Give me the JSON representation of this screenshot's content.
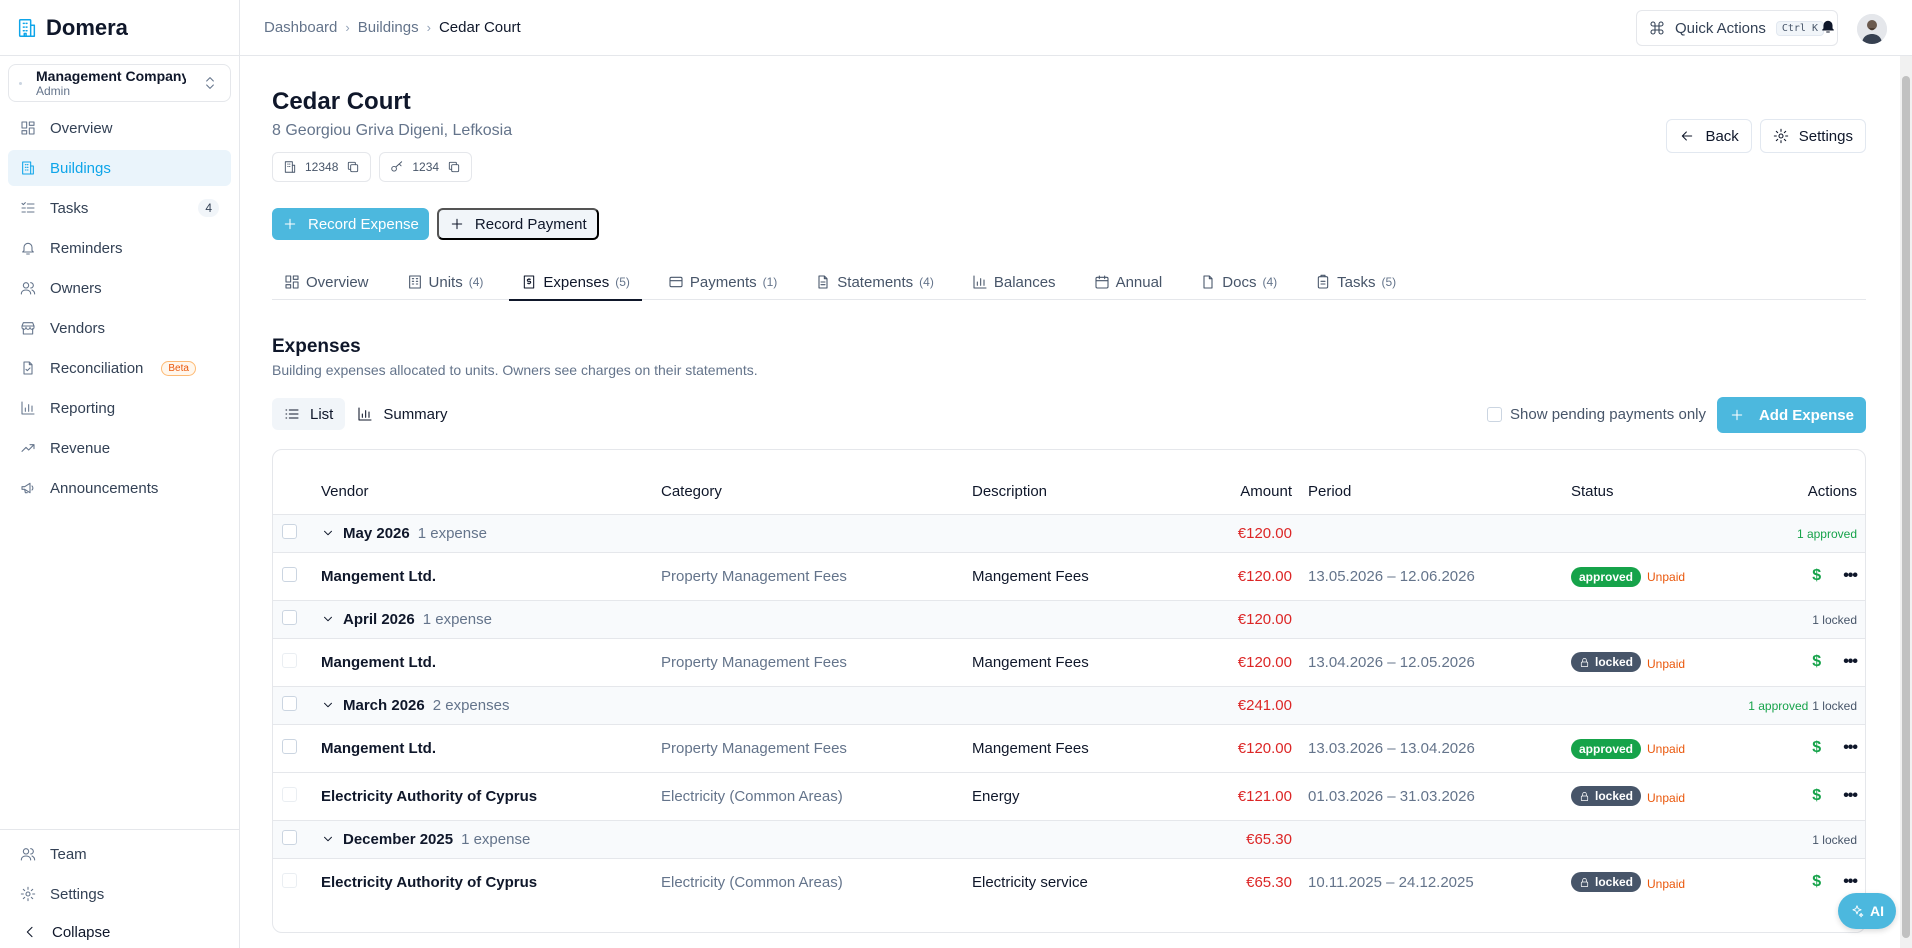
{
  "brand": {
    "name": "Domera"
  },
  "org": {
    "name": "Management Company",
    "role": "Admin"
  },
  "nav": [
    {
      "label": "Overview",
      "icon": "grid-icon"
    },
    {
      "label": "Buildings",
      "icon": "building-icon",
      "active": true
    },
    {
      "label": "Tasks",
      "icon": "tasks-icon",
      "count": "4"
    },
    {
      "label": "Reminders",
      "icon": "bell-icon"
    },
    {
      "label": "Owners",
      "icon": "users-icon"
    },
    {
      "label": "Vendors",
      "icon": "store-icon"
    },
    {
      "label": "Reconciliation",
      "icon": "file-check-icon",
      "badge": "Beta"
    },
    {
      "label": "Reporting",
      "icon": "bar-chart-icon"
    },
    {
      "label": "Revenue",
      "icon": "trend-icon"
    },
    {
      "label": "Announcements",
      "icon": "megaphone-icon"
    }
  ],
  "nav_bottom": {
    "team": "Team",
    "settings": "Settings",
    "collapse": "Collapse"
  },
  "breadcrumb": [
    "Dashboard",
    "Buildings",
    "Cedar Court"
  ],
  "topbar": {
    "quick_actions": "Quick Actions",
    "shortcut": "Ctrl K"
  },
  "building": {
    "title": "Cedar Court",
    "address": "8 Georgiou Griva Digeni, Lefkosia",
    "chip_id": "12348",
    "chip_key": "1234"
  },
  "header_actions": {
    "back": "Back",
    "settings": "Settings"
  },
  "actions": {
    "record_expense": "Record Expense",
    "record_payment": "Record Payment"
  },
  "tabs": [
    {
      "label": "Overview",
      "count": ""
    },
    {
      "label": "Units",
      "count": "(4)"
    },
    {
      "label": "Expenses",
      "count": "(5)",
      "active": true
    },
    {
      "label": "Payments",
      "count": "(1)"
    },
    {
      "label": "Statements",
      "count": "(4)"
    },
    {
      "label": "Balances",
      "count": ""
    },
    {
      "label": "Annual",
      "count": ""
    },
    {
      "label": "Docs",
      "count": "(4)"
    },
    {
      "label": "Tasks",
      "count": "(5)"
    }
  ],
  "section": {
    "title": "Expenses",
    "subtitle": "Building expenses allocated to units. Owners see charges on their statements.",
    "view_list": "List",
    "view_summary": "Summary",
    "pending_only": "Show pending payments only",
    "add_expense": "Add Expense"
  },
  "table": {
    "headers": {
      "vendor": "Vendor",
      "category": "Category",
      "description": "Description",
      "amount": "Amount",
      "period": "Period",
      "status": "Status",
      "actions": "Actions"
    },
    "groups": [
      {
        "month": "May 2026",
        "count": "1 expense",
        "total": "€120.00",
        "approved": "1 approved",
        "locked": "",
        "rows": [
          {
            "vendor": "Mangement Ltd.",
            "category": "Property Management Fees",
            "description": "Mangement Fees",
            "amount": "€120.00",
            "period": "13.05.2026 – 12.06.2026",
            "status": "approved",
            "payment": "Unpaid"
          }
        ]
      },
      {
        "month": "April 2026",
        "count": "1 expense",
        "total": "€120.00",
        "approved": "",
        "locked": "1 locked",
        "rows": [
          {
            "vendor": "Mangement Ltd.",
            "category": "Property Management Fees",
            "description": "Mangement Fees",
            "amount": "€120.00",
            "period": "13.04.2026 – 12.05.2026",
            "status": "locked",
            "payment": "Unpaid"
          }
        ]
      },
      {
        "month": "March 2026",
        "count": "2 expenses",
        "total": "€241.00",
        "approved": "1 approved",
        "locked": "1 locked",
        "rows": [
          {
            "vendor": "Mangement Ltd.",
            "category": "Property Management Fees",
            "description": "Mangement Fees",
            "amount": "€120.00",
            "period": "13.03.2026 – 13.04.2026",
            "status": "approved",
            "payment": "Unpaid"
          },
          {
            "vendor": "Electricity Authority of Cyprus",
            "category": "Electricity (Common Areas)",
            "description": "Energy",
            "amount": "€121.00",
            "period": "01.03.2026 – 31.03.2026",
            "status": "locked",
            "payment": "Unpaid"
          }
        ]
      },
      {
        "month": "December 2025",
        "count": "1 expense",
        "total": "€65.30",
        "approved": "",
        "locked": "1 locked",
        "rows": [
          {
            "vendor": "Electricity Authority of Cyprus",
            "category": "Electricity (Common Areas)",
            "description": "Electricity service",
            "amount": "€65.30",
            "period": "10.11.2025 – 24.12.2025",
            "status": "locked",
            "payment": "Unpaid"
          }
        ]
      }
    ]
  },
  "ai_button": "AI",
  "colors": {
    "accent": "#4cb8de",
    "approved": "#16a34a",
    "locked": "#475569",
    "amount": "#dc2626",
    "unpaid": "#ea580c"
  }
}
